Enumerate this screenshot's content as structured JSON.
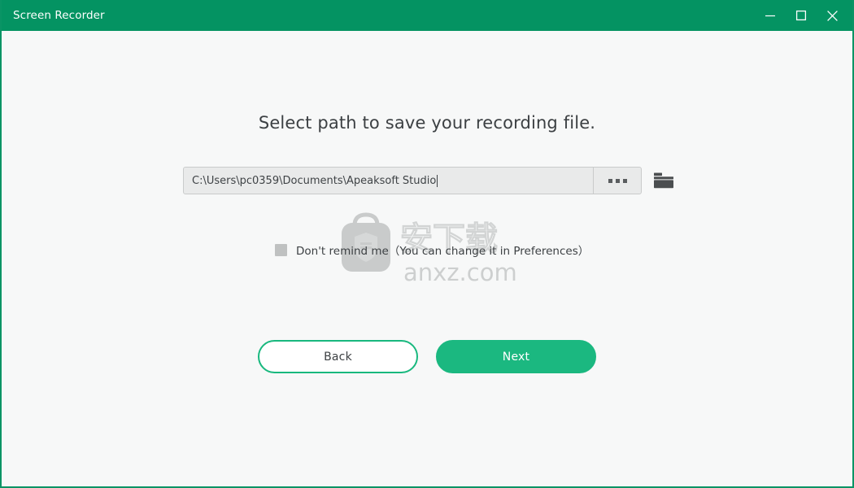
{
  "window": {
    "title": "Screen Recorder",
    "accent_green": "#049362",
    "button_green": "#1bb880",
    "body_background": "#f7f8f8",
    "controls": [
      {
        "name": "minimize",
        "label": "—"
      },
      {
        "name": "maximize",
        "label": "□"
      },
      {
        "name": "close",
        "label": "✕"
      }
    ]
  },
  "main": {
    "heading": "Select path to save your recording file.",
    "path_field": {
      "value": "C:\\Users\\pc0359\\Documents\\Apeaksoft Studio",
      "placeholder": "C:\\Users\\pc0359\\Documents\\Apeaksoft Studio",
      "browse_label": "...",
      "browse_icon": "ellipsis-icon",
      "folder_icon": "folder-icon"
    },
    "remind_checkbox": {
      "checked": false,
      "label": "Don't remind me（You can change it in Preferences）"
    }
  },
  "watermark": {
    "logo_icon": "bag-shield-logo",
    "chinese_text": "安下载",
    "site_text": "anxz.com",
    "color": "#c9cbcb"
  },
  "footer": {
    "back_label": "Back",
    "next_label": "Next"
  }
}
